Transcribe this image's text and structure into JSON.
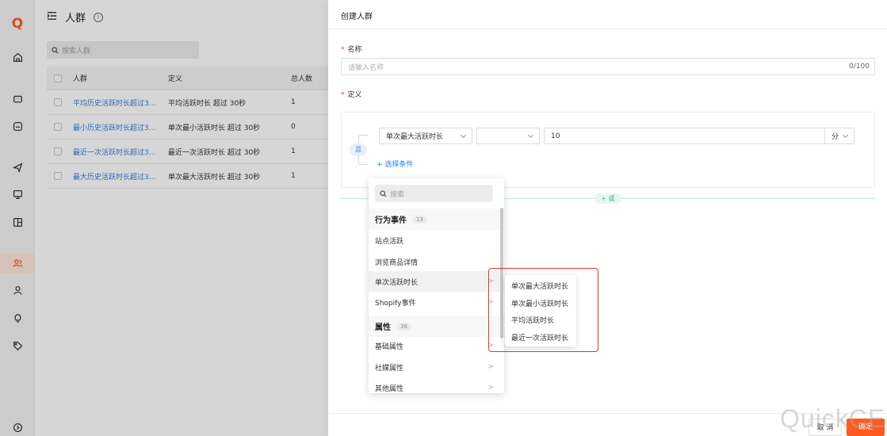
{
  "sidebar": {
    "logo": "Q",
    "icons": [
      "home-icon",
      "message-icon",
      "inbox-icon",
      "send-icon",
      "monitor-icon",
      "layout-icon",
      "users-icon",
      "user-icon",
      "bulb-icon",
      "tag-icon",
      "circle-arrow-icon"
    ],
    "active": "users-icon"
  },
  "list_page": {
    "title": "人群",
    "search_placeholder": "搜索人群",
    "columns": [
      "人群",
      "定义",
      "总人数"
    ],
    "rows": [
      {
        "name": "平均历史活跃时长超过3...",
        "definition": "平均活跃时长 超过 30秒",
        "count": "1"
      },
      {
        "name": "最小历史活跃时长超过3...",
        "definition": "单次最小活跃时长 超过 30秒",
        "count": "0"
      },
      {
        "name": "最近一次活跃时长超过3...",
        "definition": "最近一次活跃时长 超过 30秒",
        "count": "1"
      },
      {
        "name": "最大历史活跃时长超过3...",
        "definition": "单次最大活跃时长 超过 30秒",
        "count": "1"
      }
    ]
  },
  "drawer": {
    "title": "创建人群",
    "name_label": "名称",
    "name_placeholder": "请输入名称",
    "name_counter": "0/100",
    "definition_label": "定义",
    "and_label": "且",
    "condition": {
      "field": "单次最大活跃时长",
      "operator": "",
      "value": "10",
      "unit": "分"
    },
    "add_condition": "+ 选择条件",
    "or_button": "+ 或",
    "cancel": "取 消",
    "confirm": "确定"
  },
  "dropdown": {
    "search_placeholder": "搜索",
    "sections": [
      {
        "title": "行为事件",
        "count": "13",
        "items": [
          {
            "label": "站点活跃",
            "has_children": false
          },
          {
            "label": "浏览商品详情",
            "has_children": false
          },
          {
            "label": "单次活跃时长",
            "has_children": true,
            "highlighted": true
          },
          {
            "label": "Shopify事件",
            "has_children": true
          }
        ]
      },
      {
        "title": "属性",
        "count": "36",
        "items": [
          {
            "label": "基础属性",
            "has_children": true
          },
          {
            "label": "社媒属性",
            "has_children": true
          },
          {
            "label": "其他属性",
            "has_children": true
          }
        ]
      }
    ],
    "submenu": [
      "单次最大活跃时长",
      "单次最小活跃时长",
      "平均活跃时长",
      "最近一次活跃时长"
    ]
  },
  "watermark": "QuickCEP",
  "colors": {
    "accent": "#ff5a1f",
    "link": "#2d7fe0",
    "highlight_box": "#e5372c",
    "or_green": "#3bb58a"
  }
}
